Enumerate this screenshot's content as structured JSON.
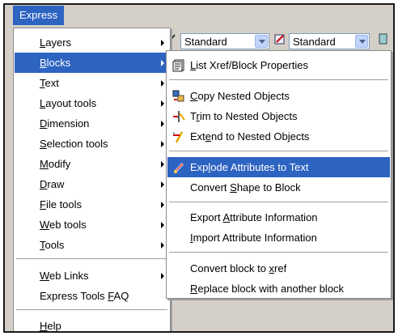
{
  "menubar": {
    "title": "Express"
  },
  "toolbar": {
    "combo1": "Standard",
    "combo2": "Standard"
  },
  "menu": {
    "items": [
      {
        "pre": "",
        "key": "L",
        "post": "ayers",
        "submenu": true
      },
      {
        "pre": "",
        "key": "B",
        "post": "locks",
        "submenu": true,
        "active": true
      },
      {
        "pre": "",
        "key": "T",
        "post": "ext",
        "submenu": true
      },
      {
        "pre": "",
        "key": "L",
        "post": "ayout tools",
        "submenu": true
      },
      {
        "pre": "",
        "key": "D",
        "post": "imension",
        "submenu": true
      },
      {
        "pre": "",
        "key": "S",
        "post": "election tools",
        "submenu": true
      },
      {
        "pre": "",
        "key": "M",
        "post": "odify",
        "submenu": true
      },
      {
        "pre": "",
        "key": "D",
        "post": "raw",
        "submenu": true
      },
      {
        "pre": "",
        "key": "F",
        "post": "ile tools",
        "submenu": true
      },
      {
        "pre": "",
        "key": "W",
        "post": "eb tools",
        "submenu": true
      },
      {
        "pre": "",
        "key": "T",
        "post": "ools",
        "submenu": true
      },
      {
        "pre": "",
        "key": "W",
        "post": "eb Links",
        "submenu": true
      },
      {
        "pre": "Express Tools ",
        "key": "F",
        "post": "AQ",
        "submenu": false
      },
      {
        "pre": "",
        "key": "H",
        "post": "elp",
        "submenu": false
      }
    ]
  },
  "submenu": {
    "items": [
      {
        "pre": "",
        "key": "L",
        "post": "ist Xref/Block Properties",
        "icon": "list-properties-icon"
      },
      {
        "pre": "",
        "key": "C",
        "post": "opy Nested Objects",
        "icon": "copy-nested-icon"
      },
      {
        "pre": "T",
        "key": "r",
        "post": "im to Nested Objects",
        "icon": "trim-nested-icon"
      },
      {
        "pre": "Ext",
        "key": "e",
        "post": "nd to Nested Objects",
        "icon": "extend-nested-icon"
      },
      {
        "pre": "Exp",
        "key": "l",
        "post": "ode Attributes to Text",
        "icon": "explode-attributes-icon",
        "active": true
      },
      {
        "pre": "Convert ",
        "key": "S",
        "post": "hape to Block",
        "icon": ""
      },
      {
        "pre": "Export ",
        "key": "A",
        "post": "ttribute Information",
        "icon": ""
      },
      {
        "pre": "",
        "key": "I",
        "post": "mport Attribute Information",
        "icon": ""
      },
      {
        "pre": "Convert block to ",
        "key": "x",
        "post": "ref",
        "icon": ""
      },
      {
        "pre": "",
        "key": "R",
        "post": "eplace block with another block",
        "icon": ""
      }
    ]
  }
}
